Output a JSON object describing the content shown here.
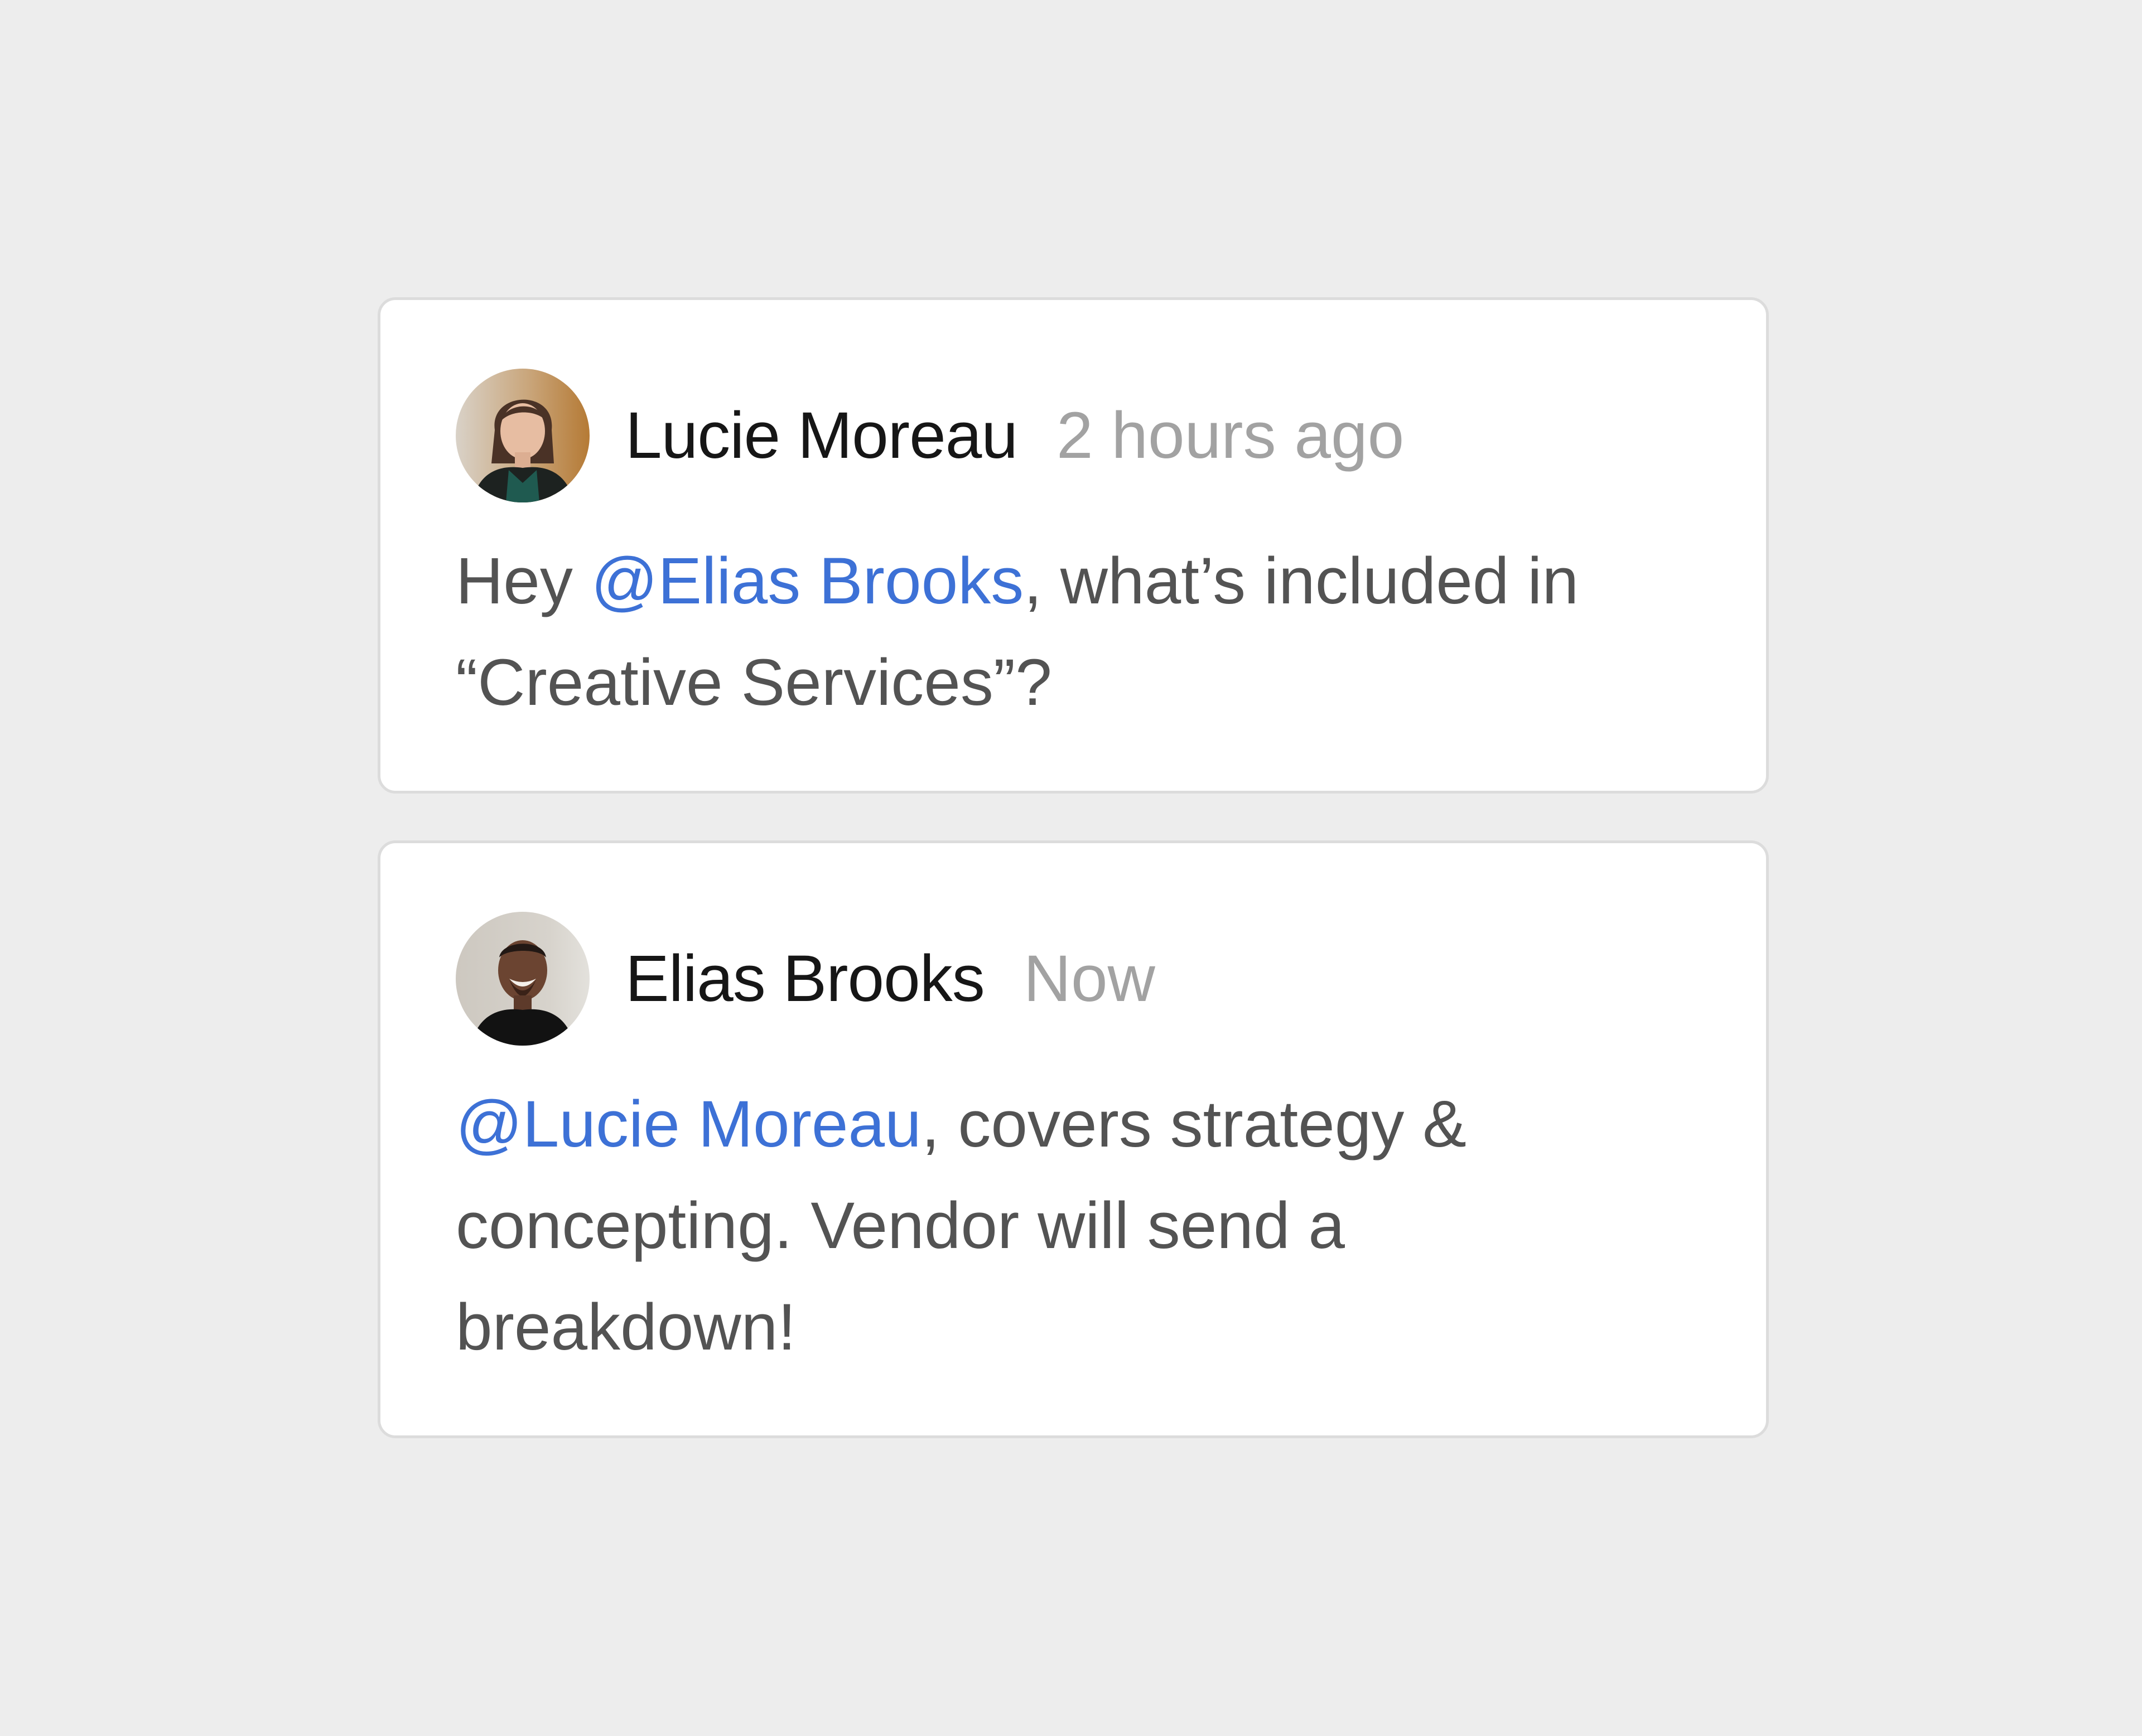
{
  "comments": [
    {
      "author": "Lucie Moreau",
      "time": "2 hours ago",
      "avatar_icon": "user-avatar-photo",
      "body_before": "Hey ",
      "mention": "@Elias Brooks",
      "body_after": ", what’s included in “Creative Services”?"
    },
    {
      "author": "Elias Brooks",
      "time": "Now",
      "avatar_icon": "user-avatar-photo",
      "body_before": "",
      "mention": "@Lucie Moreau",
      "body_after": ", covers strategy & concepting. Vendor will send a breakdown!"
    }
  ],
  "colors": {
    "background": "#ededed",
    "card": "#ffffff",
    "mention": "#3d71d6",
    "author": "#161616",
    "timestamp": "#a2a2a2",
    "body": "#535353"
  }
}
